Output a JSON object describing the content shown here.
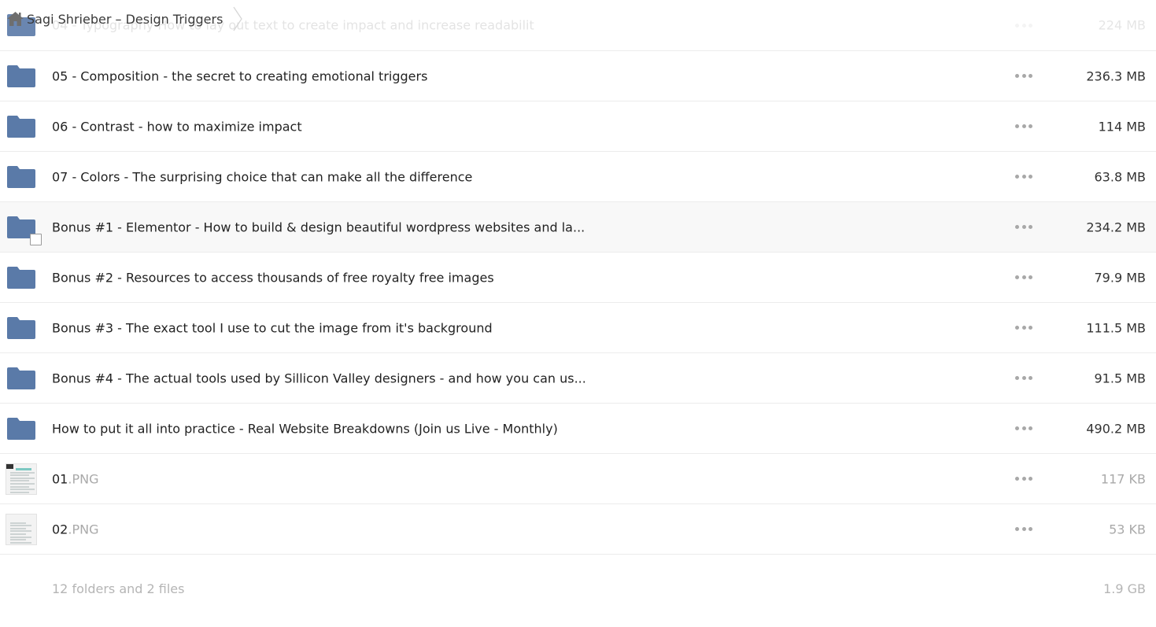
{
  "breadcrumb": {
    "home_icon": "home-icon",
    "current_folder": "Sagi Shrieber – Design Triggers",
    "separator_icon": "chevron-right-icon"
  },
  "colors": {
    "folder": "#5a7aa8",
    "folder_dark": "#4f6d98",
    "muted_text": "#a9a9a9",
    "hover_row": "#f8f8f8"
  },
  "rows": [
    {
      "type": "folder",
      "name": "04 - Typography How to lay out text to create impact and increase readabilit",
      "ext": "",
      "size": "224 MB",
      "state": "partially-hidden"
    },
    {
      "type": "folder",
      "name": "05 - Composition - the secret to creating emotional triggers",
      "ext": "",
      "size": "236.3 MB",
      "state": "normal"
    },
    {
      "type": "folder",
      "name": "06 - Contrast - how to maximize impact",
      "ext": "",
      "size": "114 MB",
      "state": "normal"
    },
    {
      "type": "folder",
      "name": "07 - Colors - The surprising choice that can make all the difference",
      "ext": "",
      "size": "63.8 MB",
      "state": "normal"
    },
    {
      "type": "folder",
      "name": "Bonus #1 - Elementor - How to build & design beautiful wordpress websites and la...",
      "ext": "",
      "size": "234.2 MB",
      "state": "hovered"
    },
    {
      "type": "folder",
      "name": "Bonus #2 - Resources to access thousands of free royalty free images",
      "ext": "",
      "size": "79.9 MB",
      "state": "normal"
    },
    {
      "type": "folder",
      "name": "Bonus #3 - The exact tool I use to cut the image from it's background",
      "ext": "",
      "size": "111.5 MB",
      "state": "normal"
    },
    {
      "type": "folder",
      "name": "Bonus #4 - The actual tools used by Sillicon Valley designers - and how you can us...",
      "ext": "",
      "size": "91.5 MB",
      "state": "normal"
    },
    {
      "type": "folder",
      "name": "How to put it all into practice - Real Website Breakdowns (Join us Live - Monthly)",
      "ext": "",
      "size": "490.2 MB",
      "state": "normal"
    },
    {
      "type": "image",
      "name": "01",
      "ext": ".PNG",
      "size": "117 KB",
      "state": "normal"
    },
    {
      "type": "image",
      "name": "02",
      "ext": ".PNG",
      "size": "53 KB",
      "state": "normal"
    }
  ],
  "summary": {
    "count_text": "12 folders and 2 files",
    "total_size": "1.9 GB"
  },
  "icons": {
    "folder": "folder-icon",
    "more": "more-options-icon",
    "checkbox": "select-checkbox"
  }
}
